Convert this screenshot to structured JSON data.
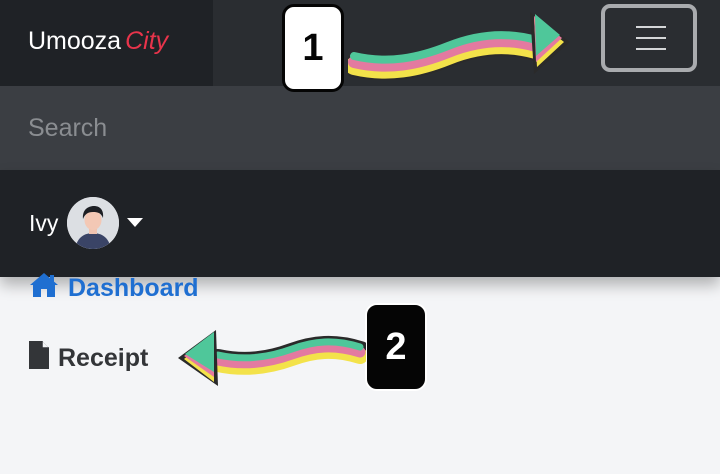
{
  "navbar": {
    "brand_name": "Umooza",
    "brand_accent": "City",
    "toggler_icon": "hamburger-menu-icon"
  },
  "search": {
    "placeholder": "Search",
    "value": ""
  },
  "user": {
    "name": "Ivy",
    "avatar_icon": "user-avatar",
    "dropdown_icon": "caret-down-icon"
  },
  "sidebar": {
    "items": [
      {
        "label": "Dashboard",
        "icon": "home-icon"
      },
      {
        "label": "Receipt",
        "icon": "file-icon"
      }
    ]
  },
  "annotations": {
    "step1": "1",
    "step2": "2"
  },
  "colors": {
    "navbar_bg": "#2a2d31",
    "brand_accent": "#e8344b",
    "link_blue": "#1f6fd1",
    "arrow_green": "#4fc79a",
    "arrow_pink": "#e37aa0",
    "arrow_yellow": "#f3e24a"
  }
}
